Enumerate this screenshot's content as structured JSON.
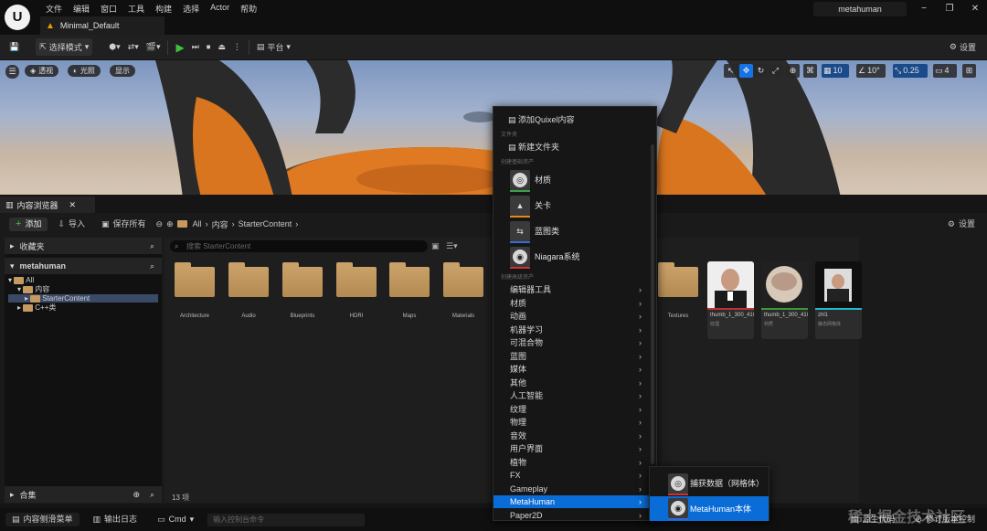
{
  "titlebar": {
    "logo": "U",
    "menus": [
      "文件",
      "编辑",
      "窗口",
      "工具",
      "构建",
      "选择",
      "Actor",
      "帮助"
    ],
    "map_tab": "Minimal_Default",
    "project_name": "metahuman"
  },
  "toolbar": {
    "select_mode": "选择模式",
    "platform": "平台",
    "settings": "设置"
  },
  "viewport": {
    "perspective": "透视",
    "lit": "光照",
    "show": "显示",
    "grid_snap": "10",
    "rot_snap": "10°",
    "scale_snap": "0.25",
    "cam_speed": "4"
  },
  "content_browser": {
    "tab": "内容浏览器",
    "add": "添加",
    "import": "导入",
    "save_all": "保存所有",
    "breadcrumb": [
      "All",
      "内容",
      "StarterContent"
    ],
    "settings": "设置",
    "favorites": "收藏夹",
    "project_root": "metahuman",
    "tree": [
      "All",
      "内容",
      "StarterContent",
      "C++类"
    ],
    "collections": "合集",
    "search_placeholder": "搜索 StarterContent",
    "item_count": "13 项",
    "folders": [
      "Architecture",
      "Audio",
      "Blueprints",
      "HDRI",
      "Maps",
      "Materials"
    ],
    "right_folder": "Textures",
    "assets": [
      {
        "name": "thumb_1_300_410_",
        "type": "纹理",
        "color": "#c03030"
      },
      {
        "name": "thumb_1_300_410_",
        "type": "材质",
        "color": "#3a9a3a"
      },
      {
        "name": "zhl1",
        "type": "静态网格体",
        "color": "#22b8d0"
      }
    ]
  },
  "context_menu": {
    "quixel": "添加Quixel内容",
    "section_folder": "文件夹",
    "new_folder": "新建文件夹",
    "section_basic": "创建基础资产",
    "basic": [
      {
        "label": "材质",
        "color": "#3aa04a"
      },
      {
        "label": "关卡",
        "color": "#e08a1a"
      },
      {
        "label": "蓝图类",
        "color": "#3a6ad8"
      },
      {
        "label": "Niagara系统",
        "color": "#d03030"
      }
    ],
    "section_advanced": "创建高级资产",
    "advanced": [
      "编辑器工具",
      "材质",
      "动画",
      "机器学习",
      "可混合物",
      "蓝图",
      "媒体",
      "其他",
      "人工智能",
      "纹理",
      "物理",
      "音效",
      "用户界面",
      "植物",
      "FX",
      "Gameplay",
      "MetaHuman",
      "Paper2D"
    ],
    "highlighted": "MetaHuman"
  },
  "submenu": {
    "items": [
      {
        "label": "捕获数据（网格体）",
        "color": "#d03030"
      },
      {
        "label": "MetaHuman本体",
        "color": "#2a6ad8"
      }
    ]
  },
  "bottom": {
    "drawer": "内容侧滑菜单",
    "output_log": "输出日志",
    "cmd": "Cmd",
    "console_placeholder": "输入控制台命令",
    "source_control": "源生代码",
    "revision": "修订版本控制",
    "watermark": "稀土掘金技术社区"
  },
  "colors": {
    "accent": "#1473e6",
    "highlight": "#0a6cd6"
  }
}
